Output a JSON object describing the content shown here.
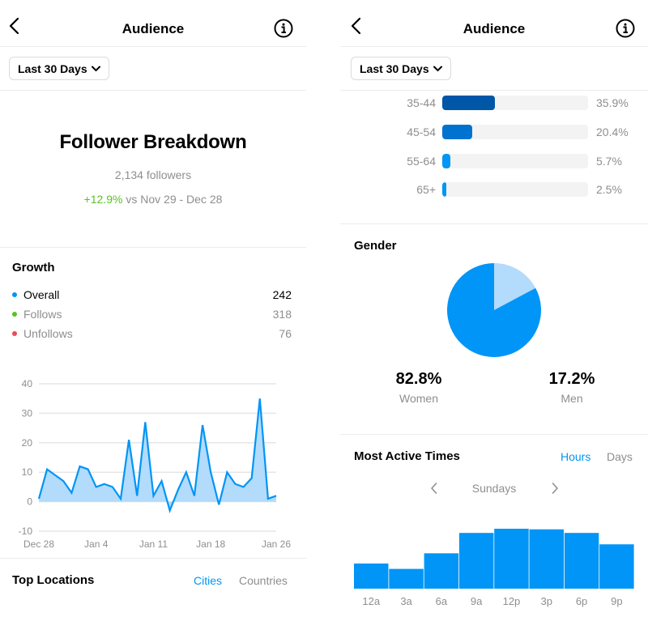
{
  "left_panel": {
    "header": {
      "title": "Audience",
      "back_icon": "chevron-left-icon",
      "info_icon": "info-circle-icon"
    },
    "filter": {
      "label": "Last 30 Days",
      "icon": "chevron-down-icon"
    },
    "breakdown": {
      "title": "Follower Breakdown",
      "followers": "2,134 followers",
      "delta_pct": "+12.9%",
      "delta_text": " vs Nov 29 - Dec 28"
    },
    "growth": {
      "title": "Growth",
      "legend": [
        {
          "label": "Overall",
          "value": "242",
          "color": "#0095f6"
        },
        {
          "label": "Follows",
          "value": "318",
          "color": "#58c322"
        },
        {
          "label": "Unfollows",
          "value": "76",
          "color": "#ed4956"
        }
      ]
    },
    "top_locations": {
      "title": "Top Locations",
      "tabs": [
        {
          "label": "Cities",
          "active": true
        },
        {
          "label": "Countries",
          "active": false
        }
      ]
    }
  },
  "right_panel": {
    "header": {
      "title": "Audience",
      "back_icon": "chevron-left-icon",
      "info_icon": "info-circle-icon"
    },
    "filter": {
      "label": "Last 30 Days",
      "icon": "chevron-down-icon"
    },
    "age_range": [
      {
        "label": "35-44",
        "pct": "35.9%",
        "value": 35.9,
        "color": "#0057a8"
      },
      {
        "label": "45-54",
        "pct": "20.4%",
        "value": 20.4,
        "color": "#0072d0"
      },
      {
        "label": "55-64",
        "pct": "5.7%",
        "value": 5.7,
        "color": "#0095f6"
      },
      {
        "label": "65+",
        "pct": "2.5%",
        "value": 2.5,
        "color": "#0095f6"
      }
    ],
    "gender": {
      "title": "Gender",
      "women": {
        "value": "82.8%",
        "label": "Women"
      },
      "men": {
        "value": "17.2%",
        "label": "Men"
      }
    },
    "most_active": {
      "title": "Most Active Times",
      "tabs": [
        {
          "label": "Hours",
          "active": true
        },
        {
          "label": "Days",
          "active": false
        }
      ],
      "day": "Sundays",
      "prev_icon": "chevron-left-icon",
      "next_icon": "chevron-right-icon"
    }
  },
  "colors": {
    "accent": "#0095f6",
    "positive": "#58c322",
    "negative": "#ed4956",
    "muted": "#8e8e8e",
    "light_blue": "#b3dbfb"
  },
  "chart_data": [
    {
      "id": "growth",
      "type": "area",
      "title": "Growth",
      "xlabel": "",
      "ylabel": "",
      "x": [
        "Dec 28",
        "Dec 29",
        "Dec 30",
        "Dec 31",
        "Jan 1",
        "Jan 2",
        "Jan 3",
        "Jan 4",
        "Jan 5",
        "Jan 6",
        "Jan 7",
        "Jan 8",
        "Jan 9",
        "Jan 10",
        "Jan 11",
        "Jan 12",
        "Jan 13",
        "Jan 14",
        "Jan 15",
        "Jan 16",
        "Jan 17",
        "Jan 18",
        "Jan 19",
        "Jan 20",
        "Jan 21",
        "Jan 22",
        "Jan 23",
        "Jan 24",
        "Jan 25",
        "Jan 26"
      ],
      "series": [
        {
          "name": "Overall",
          "color": "#0095f6",
          "fill": "#b3dbfb",
          "values": [
            1,
            11,
            9,
            7,
            3,
            12,
            11,
            5,
            6,
            5,
            1,
            21,
            2,
            27,
            2,
            7,
            -3,
            4,
            10,
            2,
            26,
            10,
            -1,
            10,
            6,
            5,
            8,
            35,
            1,
            2
          ]
        }
      ],
      "x_tick_labels": [
        "Dec 28",
        "Jan 4",
        "Jan 11",
        "Jan 18",
        "Jan 26"
      ],
      "x_tick_indices": [
        0,
        7,
        14,
        21,
        29
      ],
      "y_ticks": [
        40,
        30,
        20,
        10,
        0,
        -10
      ],
      "ylim": [
        -10,
        40
      ],
      "grid": true,
      "legend": "top"
    },
    {
      "id": "gender",
      "type": "pie",
      "title": "Gender",
      "labels": [
        "Women",
        "Men"
      ],
      "values": [
        82.8,
        17.2
      ],
      "colors": [
        "#0095f6",
        "#b3dbfb"
      ]
    },
    {
      "id": "age",
      "type": "bar",
      "orientation": "horizontal",
      "categories": [
        "35-44",
        "45-54",
        "55-64",
        "65+"
      ],
      "values": [
        35.9,
        20.4,
        5.7,
        2.5
      ],
      "xlim": [
        0,
        100
      ]
    },
    {
      "id": "most_active_hours",
      "type": "bar",
      "title": "Most Active Times",
      "subtitle": "Sundays",
      "categories": [
        "12a",
        "3a",
        "6a",
        "9a",
        "12p",
        "3p",
        "6p",
        "9p"
      ],
      "values": [
        42,
        33,
        59,
        93,
        100,
        99,
        93,
        74
      ],
      "value_unit": "relative (max = 100)",
      "color": "#0095f6"
    }
  ]
}
